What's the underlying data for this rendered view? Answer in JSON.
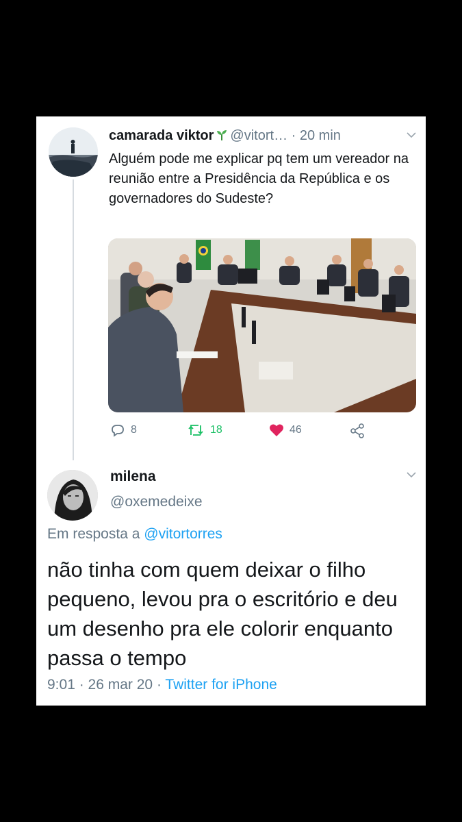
{
  "tweet": {
    "author_name": "camarada viktor",
    "author_badge_icon": "sprout-icon",
    "author_handle": "@vitort…",
    "time": "· 20 min",
    "text": "Alguém pode me explicar pq tem um vereador na reunião entre a Presidência da República e os governadores do Sudeste?",
    "replies": "8",
    "retweets": "18",
    "likes": "46"
  },
  "reply": {
    "author_name": "milena",
    "author_handle": "@oxemedeixe",
    "in_reply_label": "Em resposta a",
    "in_reply_handle": "@vitortorres",
    "text": "não tinha com quem deixar o filho pequeno, levou pra o escritório e deu um desenho pra ele colorir enquanto passa o tempo",
    "time": "9:01",
    "separator1": " · ",
    "date": "26 mar 20",
    "separator2": " · ",
    "source": "Twitter for iPhone"
  },
  "colors": {
    "link": "#1da1f2",
    "retweet": "#17bf63",
    "like": "#e0245e",
    "muted": "#657786"
  }
}
